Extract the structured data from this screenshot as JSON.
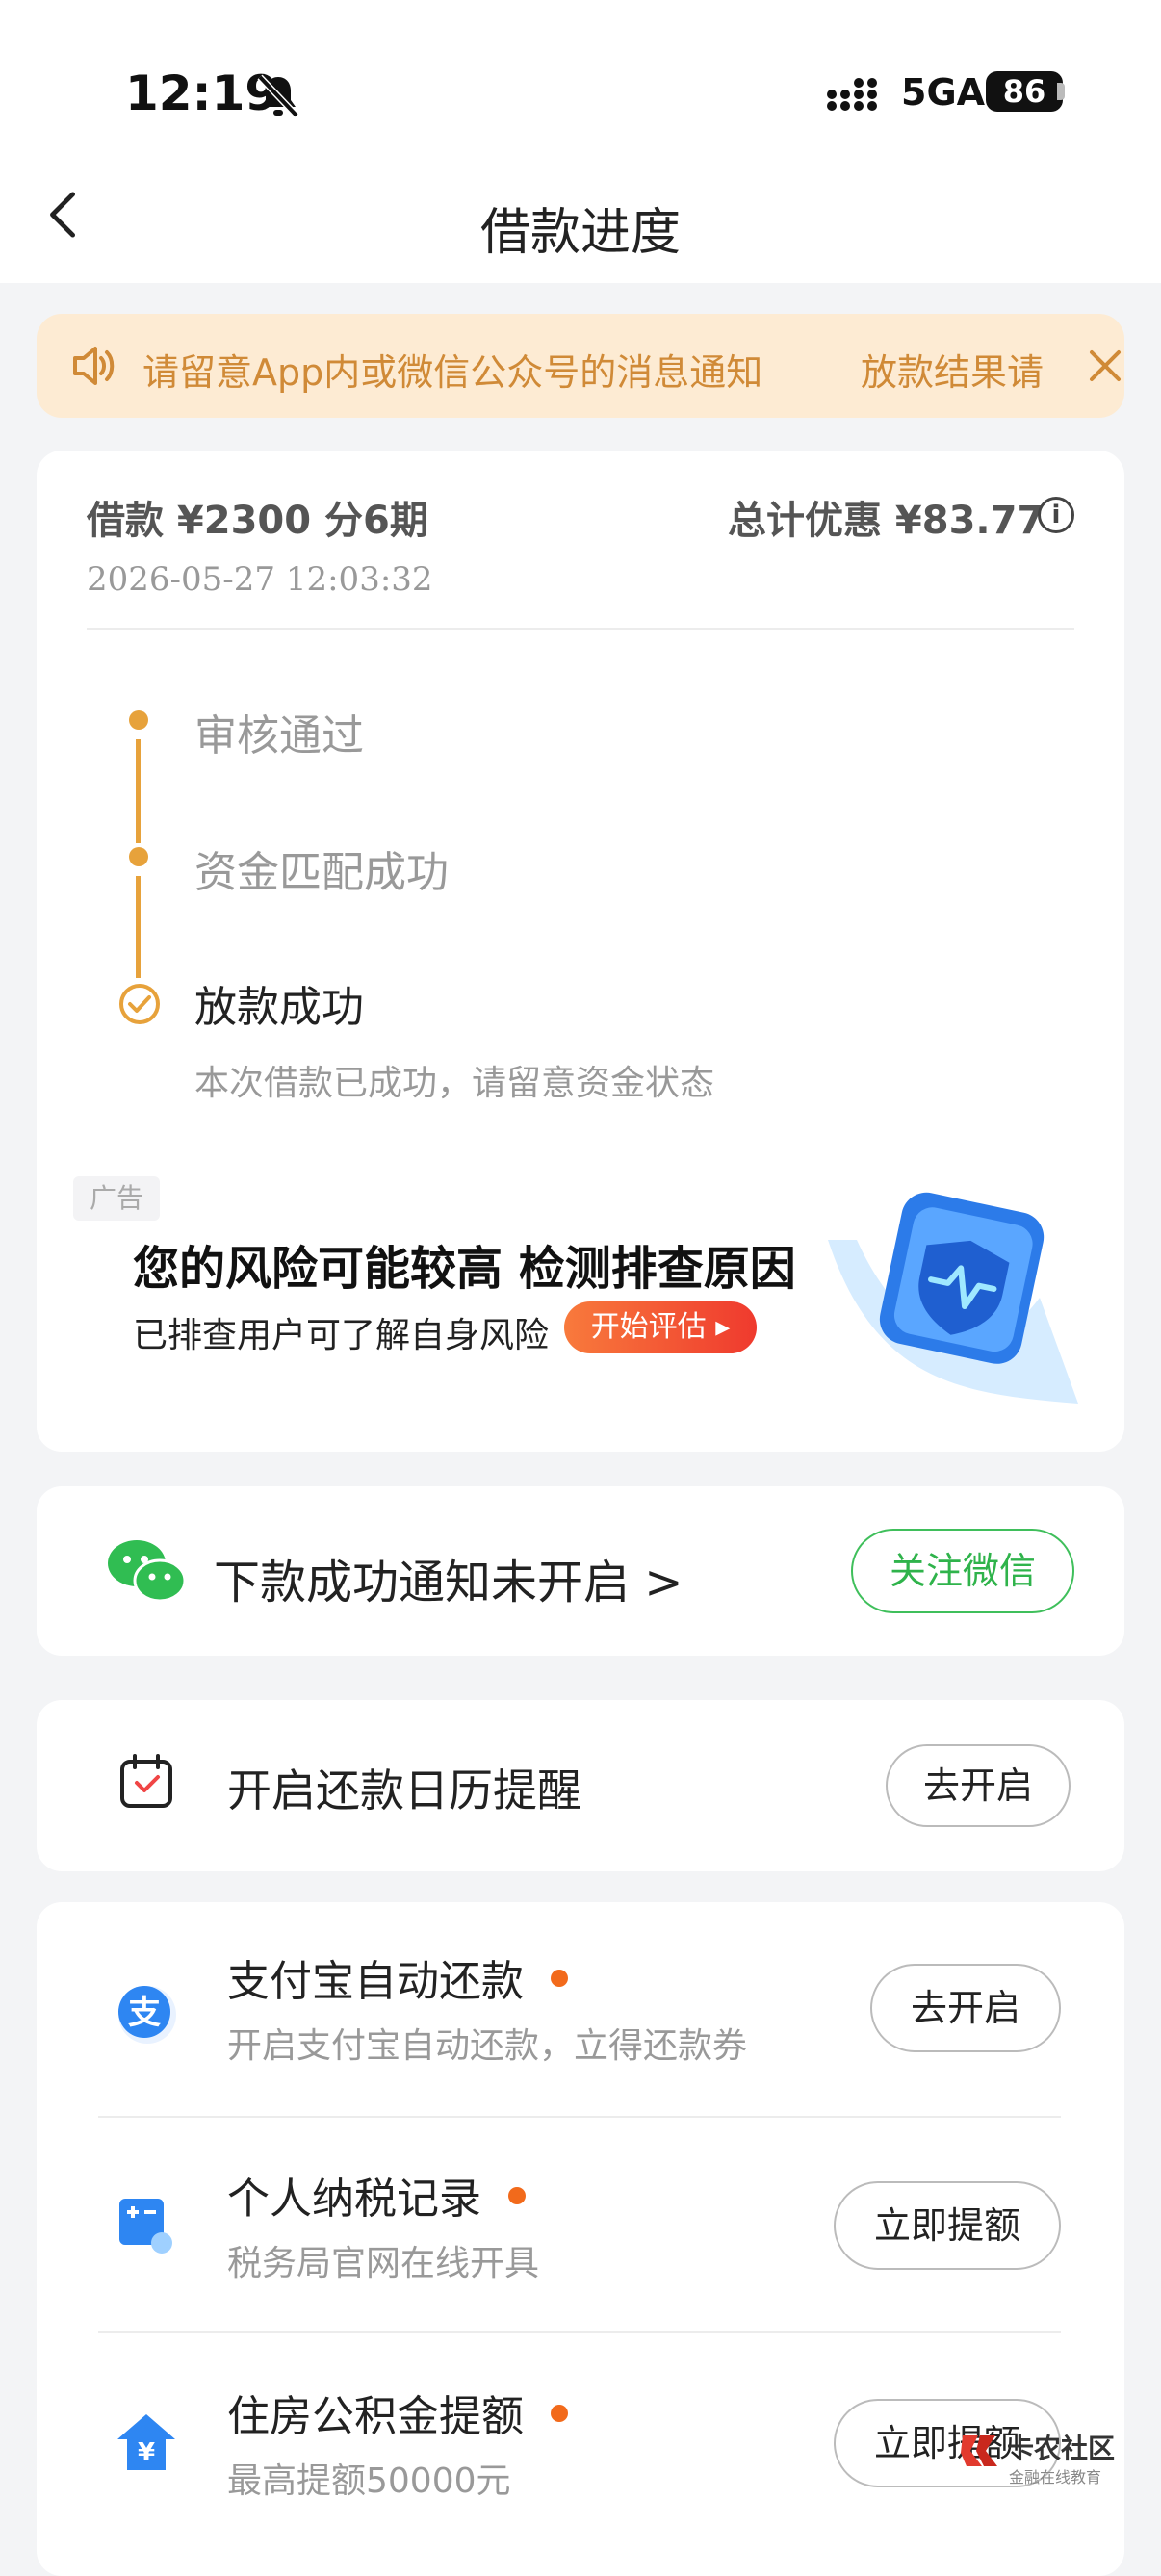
{
  "status_bar": {
    "time": "12:19",
    "network": "5GA",
    "battery": "86"
  },
  "header": {
    "title": "借款进度"
  },
  "notice": {
    "text": "请留意App内或微信公众号的消息通知",
    "text_right": "放款结果请"
  },
  "loan": {
    "amount": "借款 ¥2300 分6期",
    "discount": "总计优惠 ¥83.77",
    "datetime": "2026-05-27 12:03:32"
  },
  "timeline": {
    "steps": [
      {
        "label": "审核通过"
      },
      {
        "label": "资金匹配成功"
      },
      {
        "label": "放款成功",
        "sub": "本次借款已成功，请留意资金状态"
      }
    ]
  },
  "ad": {
    "tag": "广告",
    "title": "您的风险可能较高 检测排查原因",
    "subtitle": "已排查用户可了解自身风险",
    "button": "开始评估"
  },
  "wechat": {
    "text": "下款成功通知未开启 >",
    "button": "关注微信"
  },
  "calendar": {
    "text": "开启还款日历提醒",
    "button": "去开启"
  },
  "services": [
    {
      "title": "支付宝自动还款",
      "sub": "开启支付宝自动还款，立得还款券",
      "button": "去开启"
    },
    {
      "title": "个人纳税记录",
      "sub": "税务局官网在线开具",
      "button": "立即提额"
    },
    {
      "title": "住房公积金提额",
      "sub": "最高提额50000元",
      "button": "立即提额"
    }
  ],
  "watermark": {
    "name": "卡农社区",
    "sub": "金融在线教育"
  }
}
